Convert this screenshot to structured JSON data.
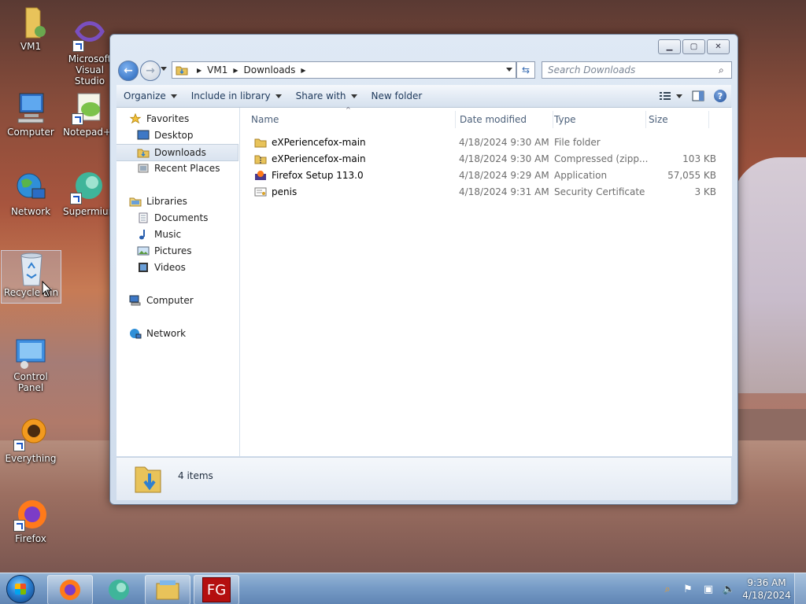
{
  "desktop": {
    "icons": [
      {
        "label": "VM1"
      },
      {
        "label": "Microsoft Visual Studio"
      },
      {
        "label": "Computer"
      },
      {
        "label": "Notepad++"
      },
      {
        "label": "Network"
      },
      {
        "label": "Supermium"
      },
      {
        "label": "Recycle Bin"
      },
      {
        "label": "Control Panel"
      },
      {
        "label": "Everything"
      },
      {
        "label": "Firefox"
      }
    ]
  },
  "window": {
    "breadcrumb": [
      "VM1",
      "Downloads"
    ],
    "search_placeholder": "Search Downloads",
    "toolbar": {
      "organize": "Organize",
      "include_in_library": "Include in library",
      "share_with": "Share with",
      "new_folder": "New folder"
    },
    "nav": {
      "favorites": "Favorites",
      "desktop": "Desktop",
      "downloads": "Downloads",
      "recent_places": "Recent Places",
      "libraries": "Libraries",
      "documents": "Documents",
      "music": "Music",
      "pictures": "Pictures",
      "videos": "Videos",
      "computer": "Computer",
      "network": "Network"
    },
    "columns": {
      "name": "Name",
      "date": "Date modified",
      "type": "Type",
      "size": "Size"
    },
    "files": [
      {
        "name": "eXPeriencefox-main",
        "date": "4/18/2024 9:30 AM",
        "type": "File folder",
        "size": "",
        "icon": "folder-icon"
      },
      {
        "name": "eXPeriencefox-main",
        "date": "4/18/2024 9:30 AM",
        "type": "Compressed (zipp...",
        "size": "103 KB",
        "icon": "zip-folder-icon"
      },
      {
        "name": "Firefox Setup 113.0",
        "date": "4/18/2024 9:29 AM",
        "type": "Application",
        "size": "57,055 KB",
        "icon": "firefox-installer-icon"
      },
      {
        "name": "penis",
        "date": "4/18/2024 9:31 AM",
        "type": "Security Certificate",
        "size": "3 KB",
        "icon": "certificate-icon"
      }
    ],
    "status": "4 items"
  },
  "taskbar": {
    "clock_time": "9:36 AM",
    "clock_date": "4/18/2024"
  }
}
